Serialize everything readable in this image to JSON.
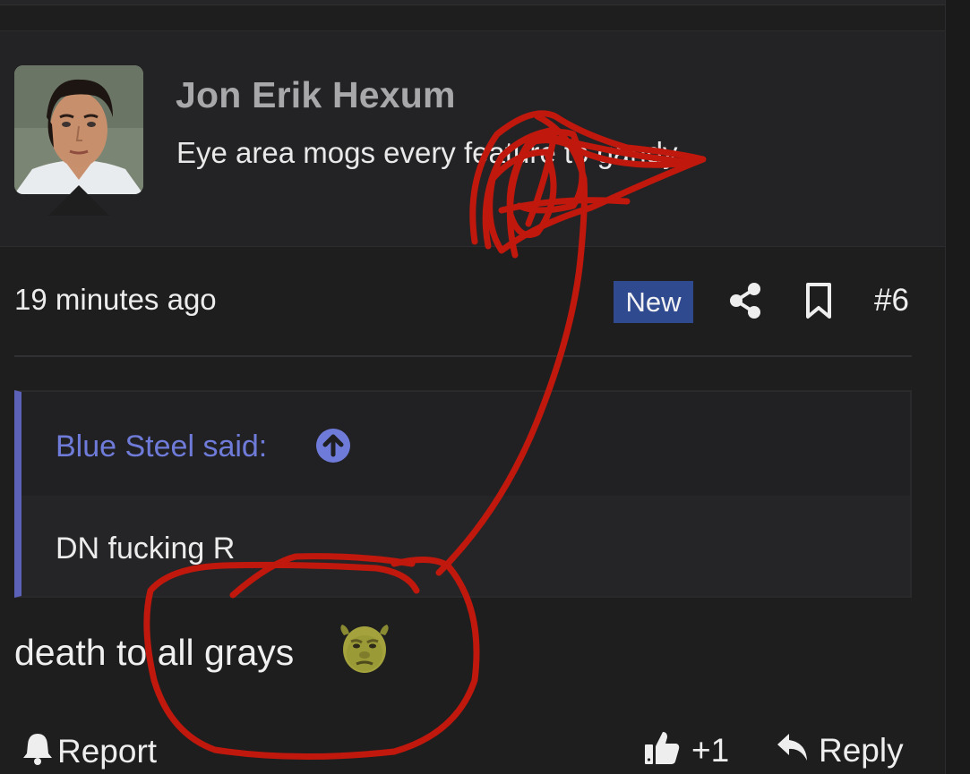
{
  "post": {
    "author": {
      "name": "Jon Erik Hexum",
      "title": "Eye area mogs every feature to gandy"
    },
    "meta": {
      "timestamp": "19 minutes ago",
      "badge": "New",
      "post_number": "#6"
    },
    "quote": {
      "author_label": "Blue Steel said:",
      "text": "DN fucking R"
    },
    "body": "death to all grays",
    "footer": {
      "report_label": "Report",
      "like_count": "+1",
      "reply_label": "Reply"
    }
  },
  "icons": {
    "share": "share-icon",
    "bookmark": "bookmark-icon",
    "quote_jump": "arrow-up-circle-icon",
    "report": "bell-icon",
    "like": "thumbs-up-icon",
    "reply": "reply-arrow-icon",
    "reaction": "ogre-face-emoji"
  },
  "colors": {
    "background": "#1e1e1f",
    "header_card": "#232325",
    "badge": "#2f4a8e",
    "quote_accent": "#5b62b8",
    "quote_author": "#6f7bd9",
    "annotation": "#c0180d"
  }
}
